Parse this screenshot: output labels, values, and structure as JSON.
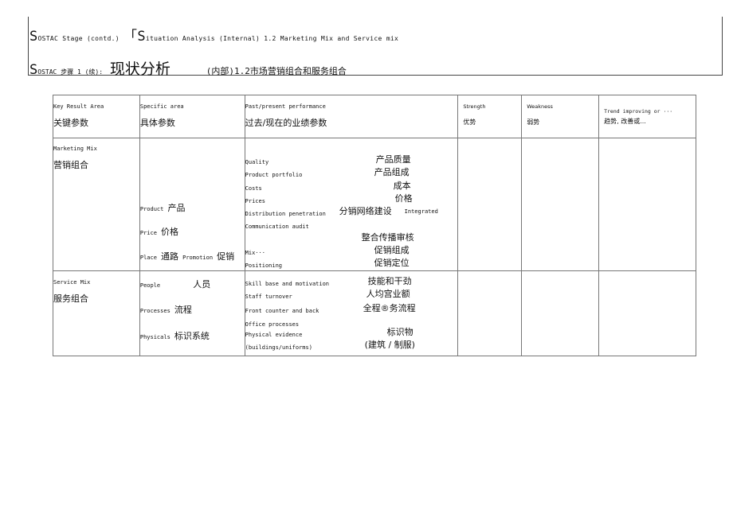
{
  "header": {
    "line1_cap1": "S",
    "line1_rest1": "OSTAC Stage (contd.)",
    "line1_bracket": "「",
    "line1_cap2": "S",
    "line1_rest2": "ituation Analysis (Internal) 1.2 Marketing Mix and Service mix",
    "line2_cap": "S",
    "line2_rest": "OSTAC 步骤 1 (续):",
    "line2_big": "现状分析",
    "line2_tail": "(内部)1.2市场营销组合和服务组合"
  },
  "table": {
    "headers": [
      {
        "en": "Key Result Area",
        "zh": "关键参数"
      },
      {
        "en": "Specific area",
        "zh": "具体参数"
      },
      {
        "en": "Past/present performance",
        "zh": "过去/现在的业绩参数"
      },
      {
        "en": "Strength",
        "zh": "优势"
      },
      {
        "en": "Weakness",
        "zh": "弱势"
      },
      {
        "en": "Trend improving or ···",
        "zh": "趋势, 改善或..."
      }
    ],
    "marketing": {
      "area_en": "Marketing Mix",
      "area_zh": "营销组合",
      "specific": [
        {
          "en": "Product",
          "zh": "产品"
        },
        {
          "en": "Price",
          "zh": "价格"
        },
        {
          "en": "Place",
          "zh": "通路",
          "en2": "Promotion",
          "zh2": "促销"
        }
      ],
      "performance": [
        {
          "en": "Quality",
          "zh": "产品质量"
        },
        {
          "en": "Product portfolio",
          "zh": "产品组成"
        },
        {
          "en": "Costs",
          "zh": "成本"
        },
        {
          "en": "Prices",
          "zh": "价格"
        },
        {
          "en": "Distribution penetration",
          "zh": "分销网络建设",
          "en2": "Integrated"
        },
        {
          "en": "Communication audit",
          "zh": ""
        },
        {
          "en": "",
          "zh": "整合传播审核"
        },
        {
          "en": "Mix···",
          "zh": "促销组成"
        },
        {
          "en": "Positioning",
          "zh": "促销定位"
        }
      ]
    },
    "service": {
      "area_en": "Service Mix",
      "area_zh": "服务组合",
      "specific": [
        {
          "en": "People",
          "zh": "人员"
        },
        {
          "en": "Processes",
          "zh": "流程"
        },
        {
          "en": "Physicals",
          "zh": "标识系统"
        }
      ],
      "performance": [
        {
          "en": "Skill base and motivation",
          "zh": "技能和干劲"
        },
        {
          "en": "Staff turnover",
          "zh": "人均宫业额"
        },
        {
          "en": "Front counter and back",
          "zh": "全程®务流程"
        },
        {
          "en": "Office processes",
          "zh": ""
        },
        {
          "en": "Physical evidence",
          "zh": "标识物"
        },
        {
          "en": "(buildings/uniforms)",
          "zh": "(建筑 / 制服)"
        }
      ]
    }
  }
}
